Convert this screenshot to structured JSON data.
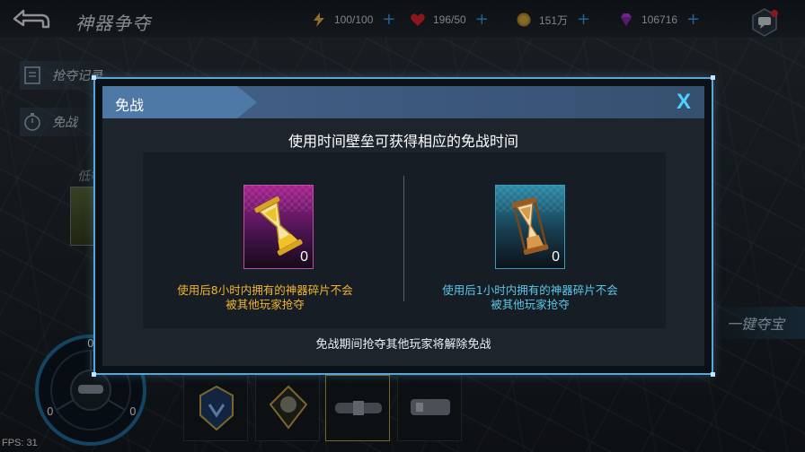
{
  "header": {
    "title": "神器争夺",
    "resources": [
      {
        "icon": "energy-icon",
        "value": "100/100"
      },
      {
        "icon": "heart-icon",
        "value": "196/50"
      },
      {
        "icon": "gold-coin-icon",
        "value": "151万"
      },
      {
        "icon": "gem-icon",
        "value": "106716"
      }
    ]
  },
  "side_menu": {
    "records": "抢夺记录",
    "truce": "免战"
  },
  "background_labels": {
    "low_level_1": "低等",
    "low_level_2": "低等"
  },
  "modal": {
    "title": "免战",
    "close": "X",
    "subtitle": "使用时间壁垒可获得相应的免战时间",
    "items": [
      {
        "icon": "gold-hourglass-icon",
        "count": "0",
        "desc_line1": "使用后8小时内拥有的神器碎片不会",
        "desc_line2": "被其他玩家抢夺",
        "color": "#f0b530"
      },
      {
        "icon": "bronze-hourglass-icon",
        "count": "0",
        "desc_line1": "使用后1小时内拥有的神器碎片不会",
        "desc_line2": "被其他玩家抢夺",
        "color": "#58c8e8"
      }
    ],
    "note": "免战期间抢夺其他玩家将解除免战"
  },
  "bottom": {
    "grab_button": "一键夺宝",
    "joystick_values": [
      "0",
      "0",
      "0"
    ],
    "fps": "FPS: 31"
  },
  "colors": {
    "accent": "#5aa6d8",
    "plus": "#3f9be8",
    "close": "#4fd0ff"
  }
}
